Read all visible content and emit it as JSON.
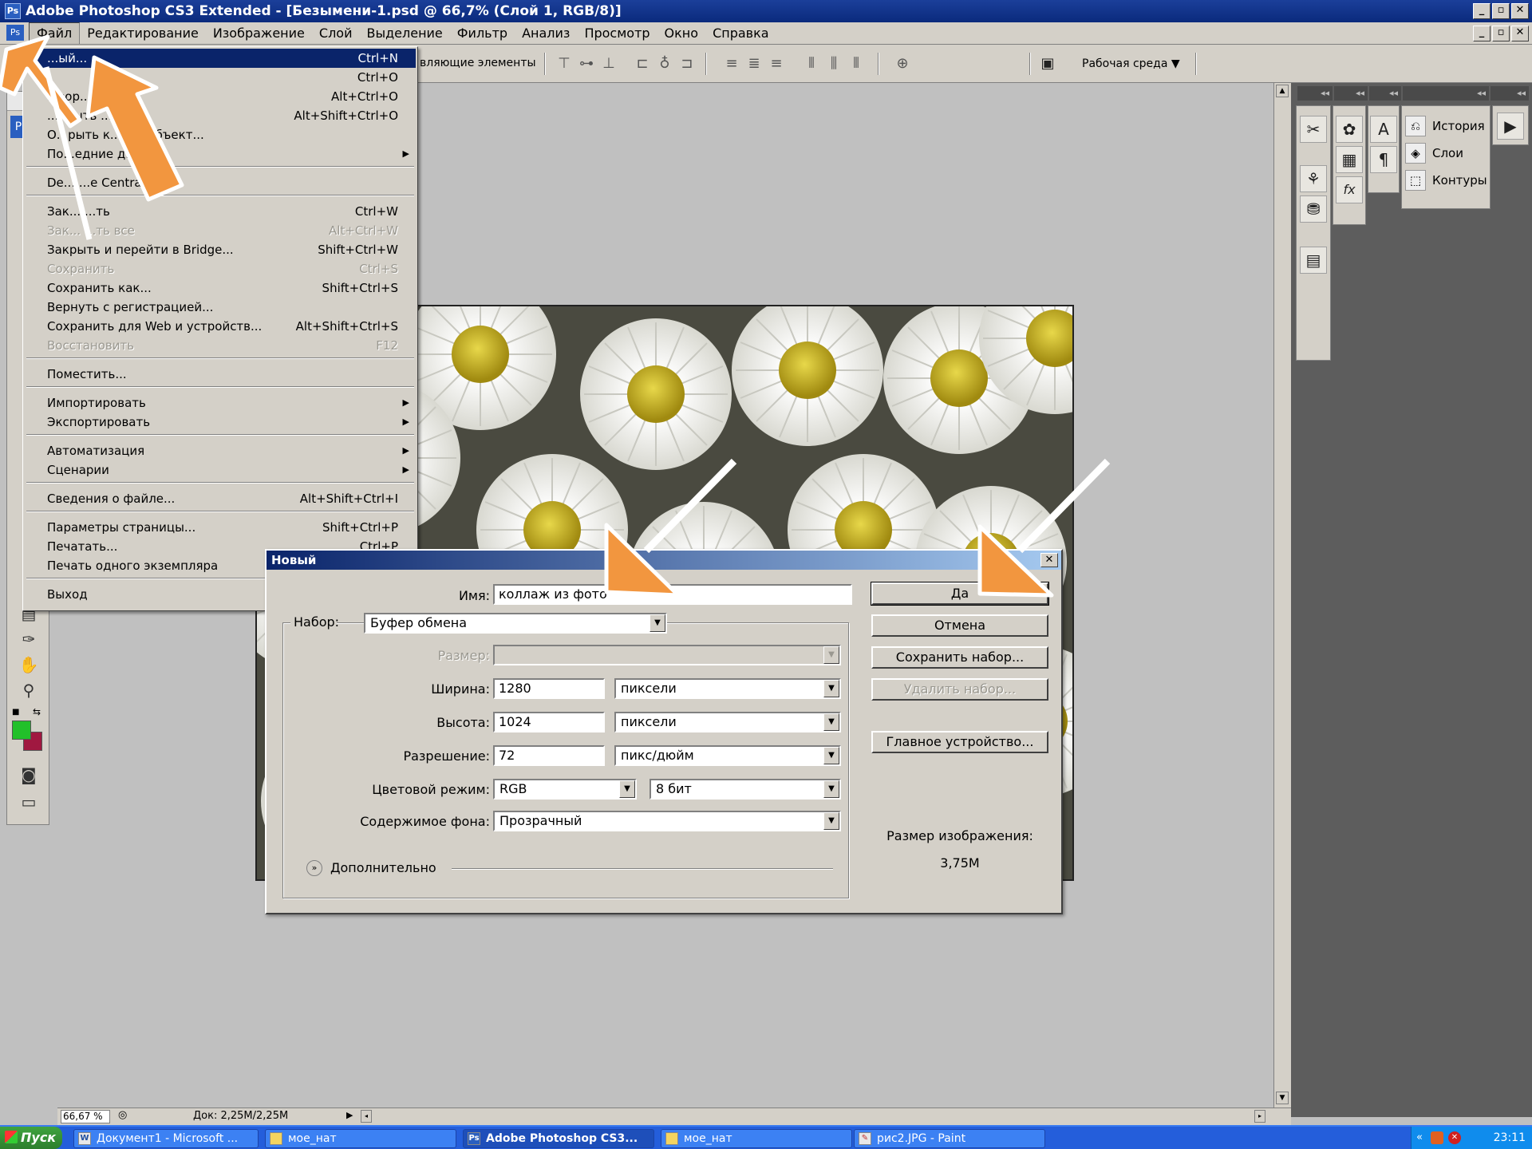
{
  "app": {
    "title": "Adobe Photoshop CS3 Extended - [Безымени-1.psd @ 66,7% (Слой 1, RGB/8)]",
    "icon": "ps-app-icon"
  },
  "menubar": {
    "items": [
      "Файл",
      "Редактирование",
      "Изображение",
      "Слой",
      "Выделение",
      "Фильтр",
      "Анализ",
      "Просмотр",
      "Окно",
      "Справка"
    ]
  },
  "options_bar": {
    "label": "вляющие элементы",
    "workspace": "Рабочая среда ▼"
  },
  "file_menu": {
    "items": [
      {
        "label": "...ый...",
        "shortcut": "Ctrl+N",
        "state": "highlighted"
      },
      {
        "label": "",
        "shortcut": "Ctrl+O"
      },
      {
        "label": "...зор...",
        "shortcut": "Alt+Ctrl+O"
      },
      {
        "label": "...крыть ...",
        "shortcut": "Alt+Shift+Ctrl+O"
      },
      {
        "label": "О...рыть к... ...т-объект...",
        "shortcut": ""
      },
      {
        "label": "По...едние д... ...ты",
        "shortcut": "",
        "submenu": true
      },
      {
        "label": "De... ...e Central...",
        "shortcut": "",
        "sep_before": true
      },
      {
        "label": "Зак... ...ть",
        "shortcut": "Ctrl+W",
        "sep_before": true
      },
      {
        "label": "Зак... ...ть все",
        "shortcut": "Alt+Ctrl+W",
        "state": "disabled"
      },
      {
        "label": "Закрыть и перейти в Bridge...",
        "shortcut": "Shift+Ctrl+W"
      },
      {
        "label": "Сохранить",
        "shortcut": "Ctrl+S",
        "state": "disabled"
      },
      {
        "label": "Сохранить как...",
        "shortcut": "Shift+Ctrl+S"
      },
      {
        "label": "Вернуть с регистрацией...",
        "shortcut": ""
      },
      {
        "label": "Сохранить для Web и устройств...",
        "shortcut": "Alt+Shift+Ctrl+S"
      },
      {
        "label": "Восстановить",
        "shortcut": "F12",
        "state": "disabled"
      },
      {
        "label": "Поместить...",
        "shortcut": "",
        "sep_before": true
      },
      {
        "label": "Импортировать",
        "shortcut": "",
        "submenu": true,
        "sep_before": true
      },
      {
        "label": "Экспортировать",
        "shortcut": "",
        "submenu": true
      },
      {
        "label": "Автоматизация",
        "shortcut": "",
        "submenu": true,
        "sep_before": true
      },
      {
        "label": "Сценарии",
        "shortcut": "",
        "submenu": true
      },
      {
        "label": "Сведения о файле...",
        "shortcut": "Alt+Shift+Ctrl+I",
        "sep_before": true
      },
      {
        "label": "Параметры страницы...",
        "shortcut": "Shift+Ctrl+P",
        "sep_before": true
      },
      {
        "label": "Печатать...",
        "shortcut": "Ctrl+P"
      },
      {
        "label": "Печать одного экземпляра",
        "shortcut": ""
      },
      {
        "label": "Выход",
        "shortcut": "",
        "sep_before": true
      }
    ]
  },
  "dialog": {
    "title": "Новый",
    "name_label": "Имя:",
    "name_value": "коллаж из фото",
    "preset_label": "Набор:",
    "preset_value": "Буфер обмена",
    "size_label": "Размер:",
    "size_value": "",
    "width_label": "Ширина:",
    "width_value": "1280",
    "width_unit": "пиксели",
    "height_label": "Высота:",
    "height_value": "1024",
    "height_unit": "пиксели",
    "resolution_label": "Разрешение:",
    "resolution_value": "72",
    "resolution_unit": "пикс/дюйм",
    "color_mode_label": "Цветовой режим:",
    "color_mode_value": "RGB",
    "bit_depth_value": "8 бит",
    "bg_label": "Содержимое фона:",
    "bg_value": "Прозрачный",
    "advanced_label": "Дополнительно",
    "buttons": {
      "ok": "Да",
      "cancel": "Отмена",
      "save_preset": "Сохранить набор...",
      "delete_preset": "Удалить набор...",
      "device_central": "Главное устройство..."
    },
    "image_size_label": "Размер изображения:",
    "image_size_value": "3,75M"
  },
  "panels": {
    "history": "История",
    "layers": "Слои",
    "paths": "Контуры"
  },
  "statusbar": {
    "zoom": "66,67 %",
    "doc": "Док: 2,25M/2,25M"
  },
  "taskbar": {
    "start": "Пуск",
    "tasks": [
      {
        "label": "Документ1 - Microsoft ...",
        "icon": "word-icon"
      },
      {
        "label": "мое_нат",
        "icon": "folder-icon"
      },
      {
        "label": "Adobe Photoshop CS3...",
        "icon": "ps-icon",
        "active": true
      },
      {
        "label": "мое_нат",
        "icon": "folder-icon"
      },
      {
        "label": "рис2.JPG - Paint",
        "icon": "paint-icon"
      }
    ],
    "clock": "23:11"
  },
  "colors": {
    "foreground": "#22c02a",
    "background": "#a01840",
    "arrow_orange": "#f2963f",
    "menu_highlight": "#0a246a"
  }
}
